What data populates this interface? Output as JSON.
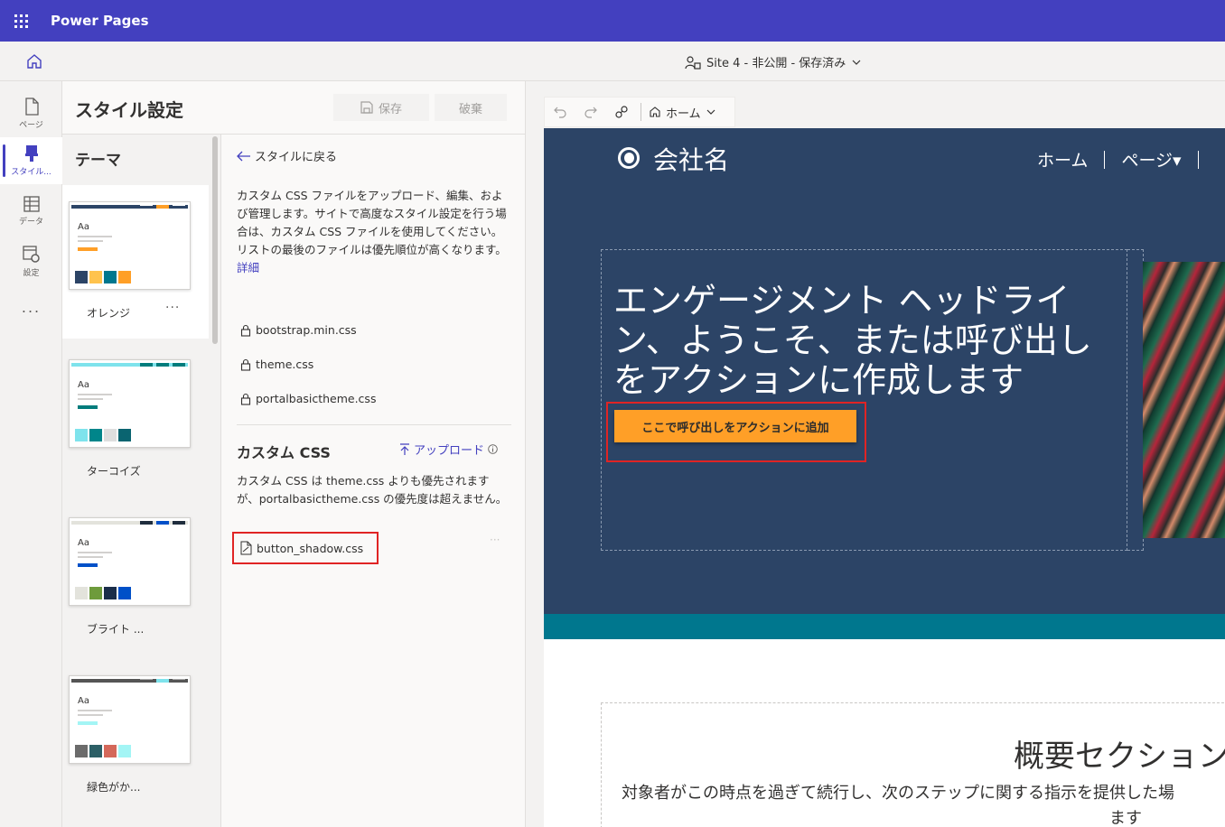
{
  "app": {
    "title": "Power Pages"
  },
  "cmdbar": {
    "site_status": "Site 4 - 非公開 - 保存済み"
  },
  "rail": {
    "items": [
      {
        "label": "ページ",
        "icon": "page-icon"
      },
      {
        "label": "スタイル...",
        "icon": "brush-icon"
      },
      {
        "label": "データ",
        "icon": "table-icon"
      },
      {
        "label": "設定",
        "icon": "settings-icon"
      },
      {
        "label": "...",
        "icon": "more-icon"
      }
    ]
  },
  "panel": {
    "title": "スタイル設定",
    "save_label": "保存",
    "discard_label": "破棄",
    "themes_heading": "テーマ",
    "themes": [
      {
        "name": "オレンジ",
        "selected": true,
        "bar": [
          "#2c4466",
          "#ff9f27",
          "#2c4466"
        ],
        "accent": "#ff9f27",
        "swatches": [
          "#2c4466",
          "#ffc34d",
          "#00778e",
          "#ff9f27"
        ]
      },
      {
        "name": "ターコイズ",
        "selected": false,
        "bar": [
          "#7ee3ec",
          "#007c7c",
          "#007c7c"
        ],
        "accent": "#007c7c",
        "swatches": [
          "#7ee3ec",
          "#00858a",
          "#dedede",
          "#0a6470"
        ]
      },
      {
        "name": "ブライト ...",
        "selected": false,
        "bar": [
          "#1f2d3d",
          "#0050c8",
          "#1f2d3d"
        ],
        "accent": "#0050c8",
        "swatches": [
          "#e3e3dc",
          "#6e9b3c",
          "#1a2d4a",
          "#0050c8"
        ]
      },
      {
        "name": "緑色がか...",
        "selected": false,
        "bar": [
          "#555555",
          "#7ee3ec",
          "#555555"
        ],
        "accent": "#a3f5f5",
        "swatches": [
          "#6b6b6b",
          "#2c5f66",
          "#d4685a",
          "#a3f5f5"
        ]
      }
    ],
    "back_label": "スタイルに戻る",
    "description": "カスタム CSS ファイルをアップロード、編集、および管理します。サイトで高度なスタイル設定を行う場合は、カスタム CSS ファイルを使用してください。リストの最後のファイルは優先順位が高くなります。",
    "more_label": "詳細",
    "locked_files": [
      "bootstrap.min.css",
      "theme.css",
      "portalbasictheme.css"
    ],
    "custom_heading": "カスタム CSS",
    "upload_label": "アップロード",
    "custom_description": "カスタム CSS は theme.css よりも優先されますが、portalbasictheme.css の優先度は超えません。",
    "custom_file": "button_shadow.css",
    "custom_file_more": "···"
  },
  "preview": {
    "page_select": "ホーム",
    "company_name": "会社名",
    "nav_home": "ホーム",
    "nav_pages": "ページ▾",
    "hero_title": "エンゲージメント ヘッドライン、ようこそ、または呼び出しをアクションに作成します",
    "cta_label": "ここで呼び出しをアクションに追加",
    "about_title": "概要セクション",
    "about_text": "対象者がこの時点を過ぎて続行し、次のステップに関する指示を提供した場",
    "about_text2": "ます"
  }
}
